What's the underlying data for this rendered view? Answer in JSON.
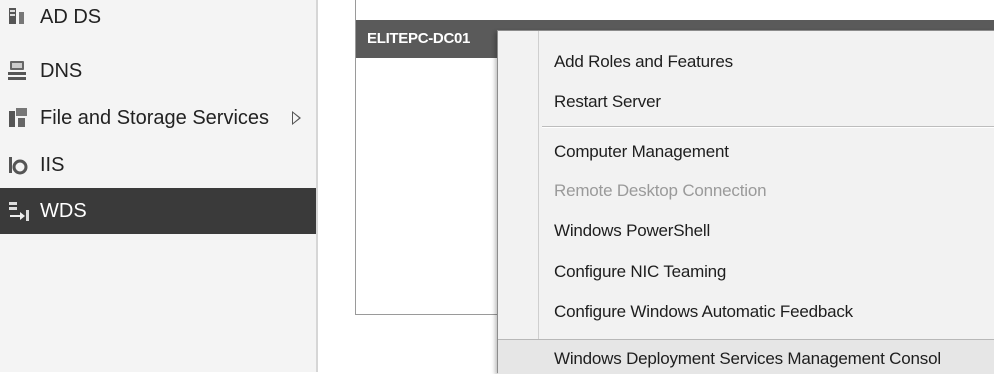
{
  "sidebar": {
    "items": [
      {
        "label": "AD DS",
        "icon": "ad-ds-icon"
      },
      {
        "label": "DNS",
        "icon": "dns-icon"
      },
      {
        "label": "File and Storage Services",
        "icon": "file-storage-icon"
      },
      {
        "label": "IIS",
        "icon": "iis-icon"
      },
      {
        "label": "WDS",
        "icon": "wds-icon",
        "selected": true
      }
    ]
  },
  "servers": {
    "rows": [
      {
        "name": "ELITEPC-DC01"
      }
    ]
  },
  "context_menu": {
    "items": [
      {
        "label": "Add Roles and Features"
      },
      {
        "label": "Restart Server"
      },
      {
        "label": "Computer Management"
      },
      {
        "label": "Remote Desktop Connection",
        "disabled": true
      },
      {
        "label": "Windows PowerShell"
      },
      {
        "label": "Configure NIC Teaming"
      },
      {
        "label": "Configure Windows Automatic Feedback"
      },
      {
        "label": "Windows Deployment Services Management Consol"
      }
    ]
  },
  "colors": {
    "selected_background": "#3a3a3a",
    "server_row_background": "#5a5a5a",
    "menu_background": "#f2f2f2",
    "disabled_text": "#9a9a9a"
  }
}
